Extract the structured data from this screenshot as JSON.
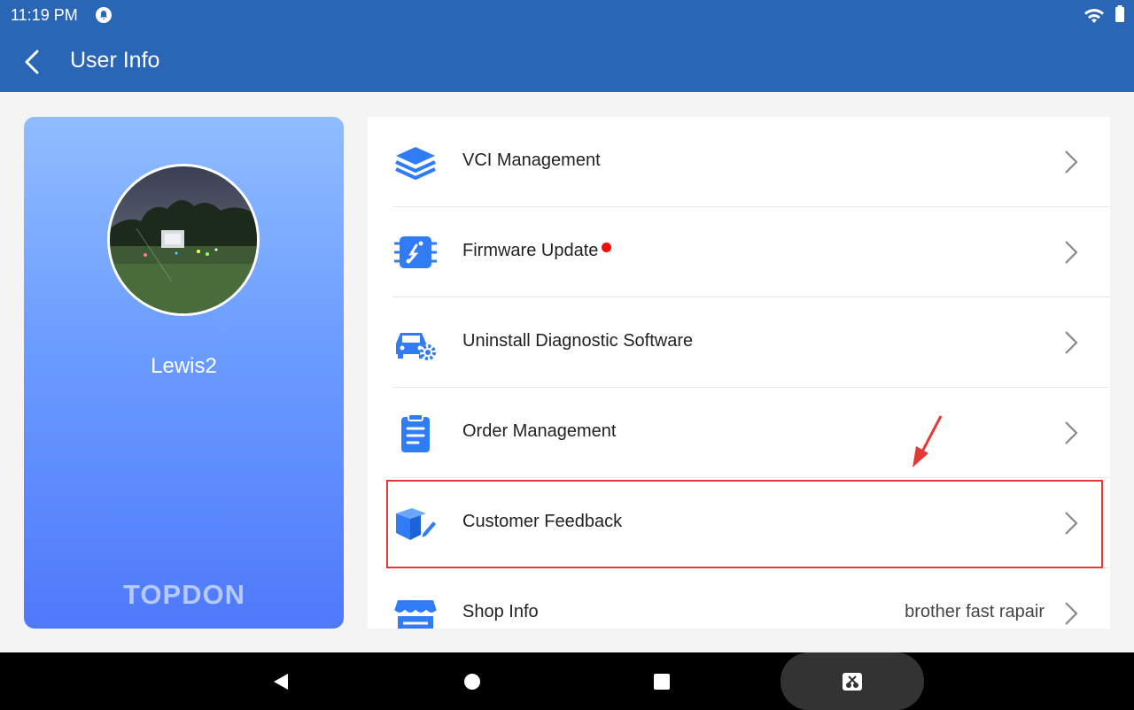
{
  "status_bar": {
    "time": "11:19 PM",
    "icons": [
      "notification-icon",
      "wifi-icon",
      "battery-icon"
    ]
  },
  "app_bar": {
    "title": "User Info",
    "back_icon": "chevron-left-icon"
  },
  "profile": {
    "username": "Lewis2",
    "brand": "TOPDON"
  },
  "menu": {
    "items": [
      {
        "id": "vci-management",
        "label": "VCI Management",
        "icon": "layers-icon"
      },
      {
        "id": "firmware-update",
        "label": "Firmware Update",
        "icon": "chip-icon",
        "badge": "red-dot"
      },
      {
        "id": "uninstall-software",
        "label": "Uninstall Diagnostic Software",
        "icon": "car-gear-icon"
      },
      {
        "id": "order-management",
        "label": "Order Management",
        "icon": "clipboard-icon"
      },
      {
        "id": "customer-feedback",
        "label": "Customer Feedback",
        "icon": "box-pencil-icon",
        "highlighted": true
      },
      {
        "id": "shop-info",
        "label": "Shop Info",
        "icon": "shop-icon",
        "value": "brother fast rapair"
      }
    ]
  },
  "nav_bar": {
    "buttons": [
      "back-triangle-icon",
      "home-circle-icon",
      "recents-square-icon",
      "screenshot-icon"
    ]
  },
  "colors": {
    "primary": "#2a66b6",
    "icon_blue": "#2f7cf6",
    "badge_red": "#f20c0c",
    "highlight_red": "#e53935"
  }
}
